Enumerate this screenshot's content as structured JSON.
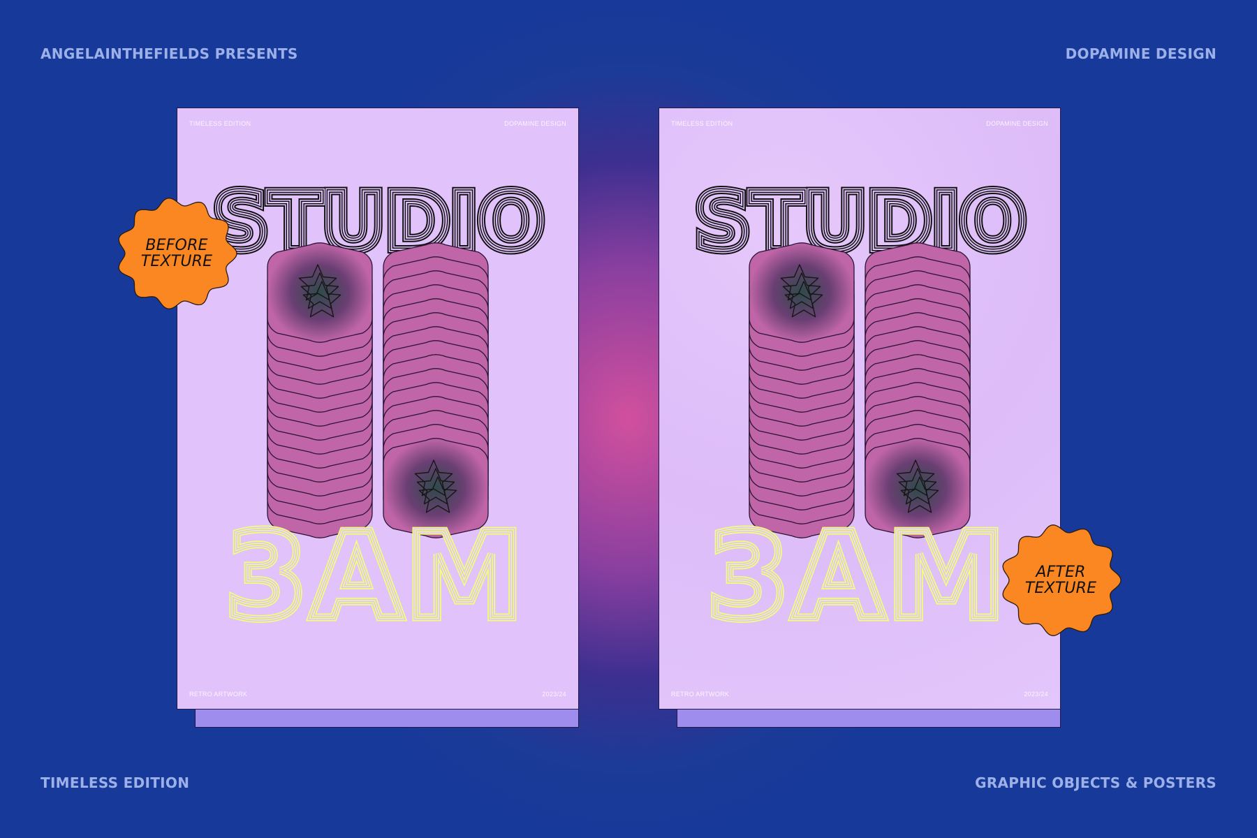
{
  "header": {
    "top_left": "ANGELAINTHEFIELDS PRESENTS",
    "top_right": "DOPAMINE DESIGN",
    "bottom_left": "TIMELESS EDITION",
    "bottom_right": "GRAPHIC OBJECTS & POSTERS"
  },
  "posters": [
    {
      "top_left": "TIMELESS EDITION",
      "top_right": "DOPAMINE DESIGN",
      "title": "STUDIO",
      "subtitle": "3AM",
      "bottom_left": "RETRO ARTWORK",
      "bottom_right": "2023/24",
      "badge_line1": "BEFORE",
      "badge_line2": "TEXTURE"
    },
    {
      "top_left": "TIMELESS EDITION",
      "top_right": "DOPAMINE DESIGN",
      "title": "STUDIO",
      "subtitle": "3AM",
      "bottom_left": "RETRO ARTWORK",
      "bottom_right": "2023/24",
      "badge_line1": "AFTER",
      "badge_line2": "TEXTURE"
    }
  ],
  "colors": {
    "background": "#16399a",
    "poster": "#e1c2fb",
    "poster_shadow": "#9f8ded",
    "badge": "#fa8721",
    "title_yellow": "#f0ff78",
    "pill": "#c065a8"
  }
}
